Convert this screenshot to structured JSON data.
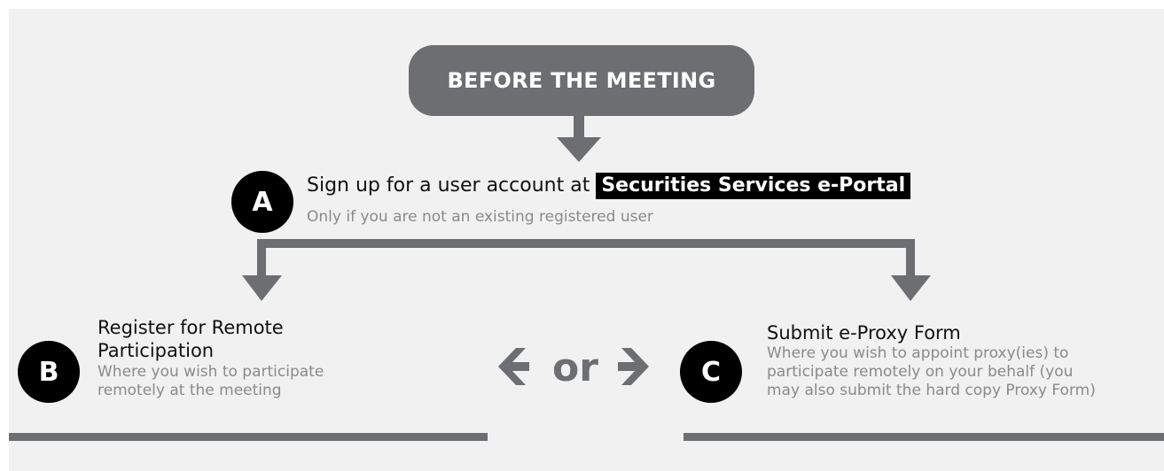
{
  "header": {
    "title": "BEFORE THE MEETING"
  },
  "step_a": {
    "badge": "A",
    "title_prefix": "Sign up for a user account at",
    "portal_label": "Securities Services e-Portal",
    "subtitle": "Only if you are not an existing registered user"
  },
  "step_b": {
    "badge": "B",
    "title_line1": "Register for Remote",
    "title_line2": "Participation",
    "subtitle_line1": "Where you wish to participate",
    "subtitle_line2": "remotely at the meeting"
  },
  "connector": {
    "label": "or"
  },
  "step_c": {
    "badge": "C",
    "title": "Submit e-Proxy Form",
    "subtitle_line1": "Where you wish to appoint proxy(ies) to",
    "subtitle_line2": "participate remotely on your behalf (you",
    "subtitle_line3": "may also submit the hard copy Proxy Form)"
  },
  "colors": {
    "pill": "#6d6e71",
    "arrow": "#6d6e71",
    "badge": "#000000",
    "panel": "#f1f1f1",
    "subtext": "#8a8a8a"
  }
}
